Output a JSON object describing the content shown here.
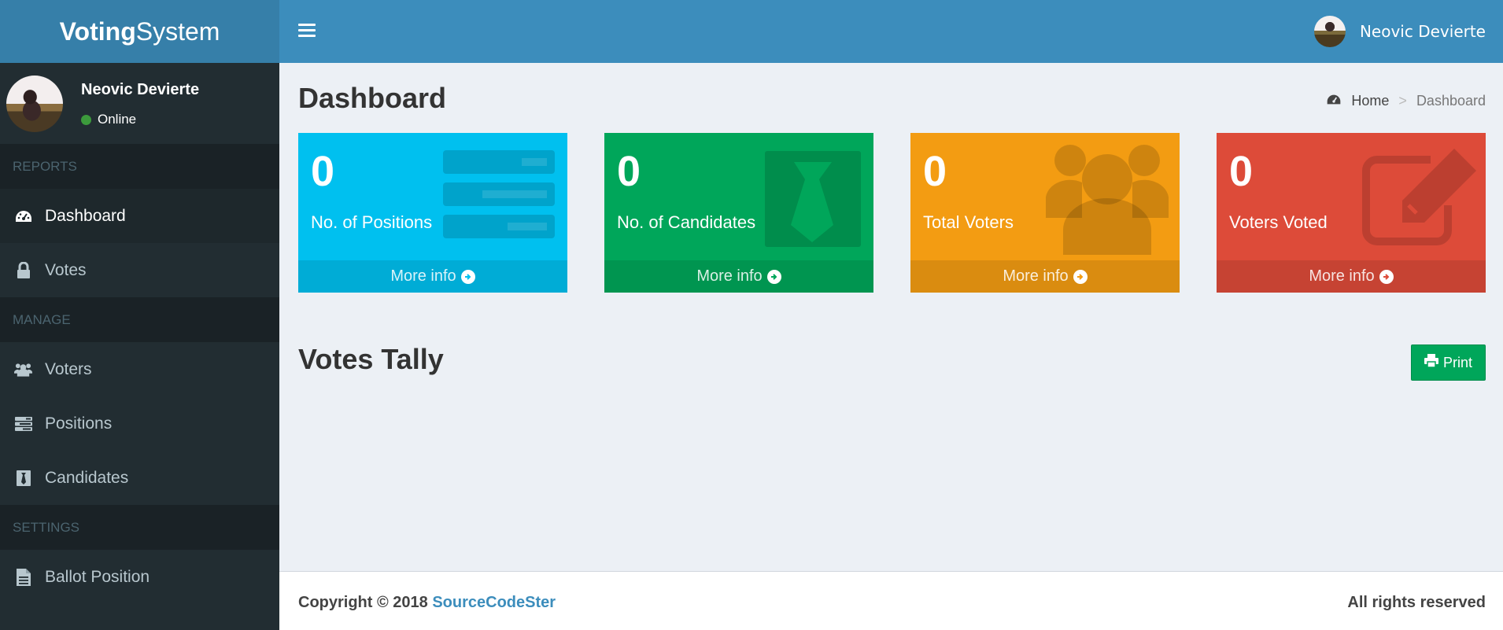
{
  "app": {
    "logo_bold": "Voting",
    "logo_rest": "System"
  },
  "topbar": {
    "user_name": "Neovic Devierte"
  },
  "sidebar": {
    "user": {
      "name": "Neovic Devierte",
      "status": "Online"
    },
    "sections": [
      {
        "header": "REPORTS",
        "items": [
          {
            "label": "Dashboard",
            "icon": "dashboard-icon"
          },
          {
            "label": "Votes",
            "icon": "lock-icon"
          }
        ]
      },
      {
        "header": "MANAGE",
        "items": [
          {
            "label": "Voters",
            "icon": "users-icon"
          },
          {
            "label": "Positions",
            "icon": "tasks-icon"
          },
          {
            "label": "Candidates",
            "icon": "black-tie-icon"
          }
        ]
      },
      {
        "header": "SETTINGS",
        "items": [
          {
            "label": "Ballot Position",
            "icon": "file-text-icon"
          }
        ]
      }
    ]
  },
  "page": {
    "title": "Dashboard",
    "breadcrumb": {
      "home": "Home",
      "separator": ">",
      "current": "Dashboard"
    }
  },
  "stats": [
    {
      "value": "0",
      "label": "No. of Positions",
      "more": "More info",
      "color": "#00c0ef",
      "icon": "tasks-icon"
    },
    {
      "value": "0",
      "label": "No. of Candidates",
      "more": "More info",
      "color": "#00a65a",
      "icon": "black-tie-icon"
    },
    {
      "value": "0",
      "label": "Total Voters",
      "more": "More info",
      "color": "#f39c12",
      "icon": "users-icon"
    },
    {
      "value": "0",
      "label": "Voters Voted",
      "more": "More info",
      "color": "#dd4b39",
      "icon": "edit-icon"
    }
  ],
  "tally": {
    "title": "Votes Tally",
    "print_label": "Print"
  },
  "footer": {
    "copyright": "Copyright © 2018",
    "link": "SourceCodeSter",
    "rights": "All rights reserved"
  }
}
